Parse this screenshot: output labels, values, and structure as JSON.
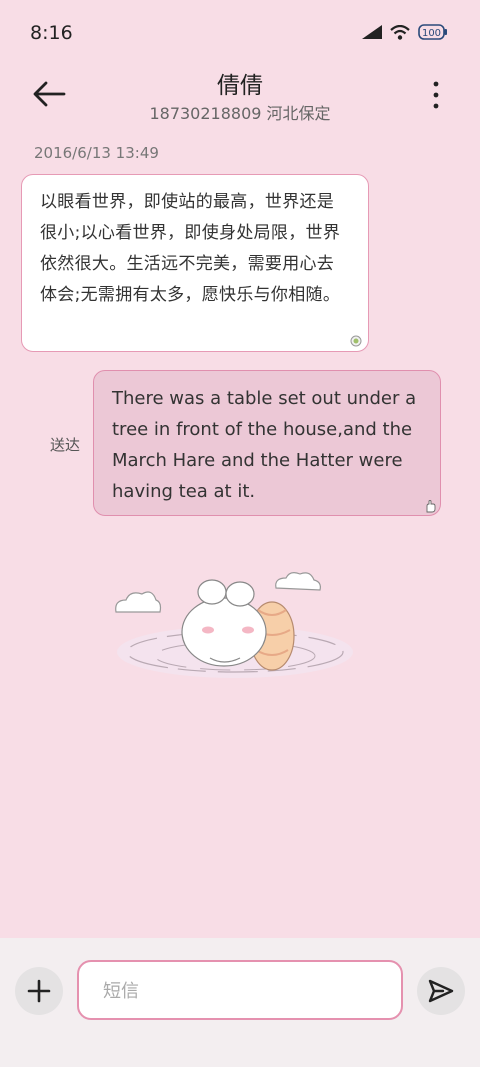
{
  "status": {
    "time": "8:16",
    "battery": "100"
  },
  "header": {
    "contact_name": "倩倩",
    "contact_detail": "18730218809 河北保定"
  },
  "conversation": {
    "timestamp": "2016/6/13 13:49",
    "incoming_message": "以眼看世界，即使站的最高，世界还是很小;以心看世界，即使身处局限，世界依然很大。生活远不完美，需要用心去体会;无需拥有太多，愿快乐与你相随。",
    "outgoing_message": "There was a table set out under a tree in front of the house,and the March Hare and the Hatter were having tea at it.",
    "outgoing_status": "送达"
  },
  "compose": {
    "placeholder": "短信",
    "value": ""
  },
  "icons": {
    "back": "arrow-left-icon",
    "more": "more-vertical-icon",
    "add": "plus-icon",
    "send": "send-icon"
  },
  "colors": {
    "background": "#f8dde6",
    "accent": "#e591af",
    "outgoing_bubble": "#ecc8d6"
  }
}
